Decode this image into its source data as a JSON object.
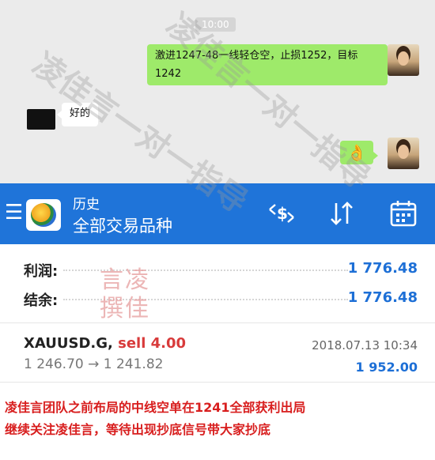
{
  "chat": {
    "time": "10:00",
    "outgoing_text": "激进1247-48一线轻仓空，止损1252，目标1242",
    "incoming_text": "好的",
    "outgoing_emoji": "👌"
  },
  "app": {
    "header_title": "历史",
    "header_subtitle": "全部交易品种",
    "icons": [
      "menu-icon",
      "app-logo-icon",
      "currency-exchange-icon",
      "sort-icon",
      "calendar-icon"
    ]
  },
  "summary": {
    "profit_label": "利润:",
    "profit_value": "1 776.48",
    "balance_label": "结余:",
    "balance_value": "1 776.48",
    "stamp_text": "言凌撰佳"
  },
  "trade": {
    "symbol": "XAUUSD.G,",
    "side": "sell 4.00",
    "datetime": "2018.07.13 10:34",
    "prices": "1 246.70 → 1 241.82",
    "profit": "1 952.00"
  },
  "caption": {
    "line1": "凌佳言团队之前布局的中线空单在1241全部获利出局",
    "line2": "继续关注凌佳言，等待出现抄底信号带大家抄底"
  },
  "watermark": {
    "text1": "凌佳言一对一指导",
    "text2": "凌佳言一对一指导"
  },
  "colors": {
    "header_blue": "#1f74d9",
    "value_blue": "#1d6fd6",
    "sell_red": "#d83b3b",
    "caption_red": "#d81e1e",
    "bubble_green": "#9eea6a"
  }
}
